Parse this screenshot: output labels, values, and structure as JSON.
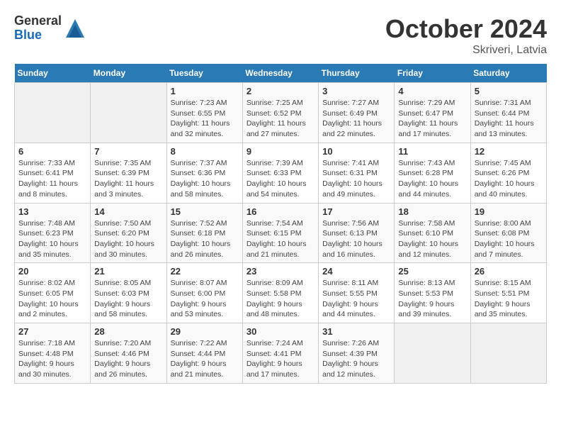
{
  "logo": {
    "general": "General",
    "blue": "Blue"
  },
  "title": {
    "month": "October 2024",
    "location": "Skriveri, Latvia"
  },
  "weekdays": [
    "Sunday",
    "Monday",
    "Tuesday",
    "Wednesday",
    "Thursday",
    "Friday",
    "Saturday"
  ],
  "weeks": [
    [
      null,
      null,
      {
        "day": 1,
        "sunrise": "7:23 AM",
        "sunset": "6:55 PM",
        "daylight": "11 hours and 32 minutes."
      },
      {
        "day": 2,
        "sunrise": "7:25 AM",
        "sunset": "6:52 PM",
        "daylight": "11 hours and 27 minutes."
      },
      {
        "day": 3,
        "sunrise": "7:27 AM",
        "sunset": "6:49 PM",
        "daylight": "11 hours and 22 minutes."
      },
      {
        "day": 4,
        "sunrise": "7:29 AM",
        "sunset": "6:47 PM",
        "daylight": "11 hours and 17 minutes."
      },
      {
        "day": 5,
        "sunrise": "7:31 AM",
        "sunset": "6:44 PM",
        "daylight": "11 hours and 13 minutes."
      }
    ],
    [
      {
        "day": 6,
        "sunrise": "7:33 AM",
        "sunset": "6:41 PM",
        "daylight": "11 hours and 8 minutes."
      },
      {
        "day": 7,
        "sunrise": "7:35 AM",
        "sunset": "6:39 PM",
        "daylight": "11 hours and 3 minutes."
      },
      {
        "day": 8,
        "sunrise": "7:37 AM",
        "sunset": "6:36 PM",
        "daylight": "10 hours and 58 minutes."
      },
      {
        "day": 9,
        "sunrise": "7:39 AM",
        "sunset": "6:33 PM",
        "daylight": "10 hours and 54 minutes."
      },
      {
        "day": 10,
        "sunrise": "7:41 AM",
        "sunset": "6:31 PM",
        "daylight": "10 hours and 49 minutes."
      },
      {
        "day": 11,
        "sunrise": "7:43 AM",
        "sunset": "6:28 PM",
        "daylight": "10 hours and 44 minutes."
      },
      {
        "day": 12,
        "sunrise": "7:45 AM",
        "sunset": "6:26 PM",
        "daylight": "10 hours and 40 minutes."
      }
    ],
    [
      {
        "day": 13,
        "sunrise": "7:48 AM",
        "sunset": "6:23 PM",
        "daylight": "10 hours and 35 minutes."
      },
      {
        "day": 14,
        "sunrise": "7:50 AM",
        "sunset": "6:20 PM",
        "daylight": "10 hours and 30 minutes."
      },
      {
        "day": 15,
        "sunrise": "7:52 AM",
        "sunset": "6:18 PM",
        "daylight": "10 hours and 26 minutes."
      },
      {
        "day": 16,
        "sunrise": "7:54 AM",
        "sunset": "6:15 PM",
        "daylight": "10 hours and 21 minutes."
      },
      {
        "day": 17,
        "sunrise": "7:56 AM",
        "sunset": "6:13 PM",
        "daylight": "10 hours and 16 minutes."
      },
      {
        "day": 18,
        "sunrise": "7:58 AM",
        "sunset": "6:10 PM",
        "daylight": "10 hours and 12 minutes."
      },
      {
        "day": 19,
        "sunrise": "8:00 AM",
        "sunset": "6:08 PM",
        "daylight": "10 hours and 7 minutes."
      }
    ],
    [
      {
        "day": 20,
        "sunrise": "8:02 AM",
        "sunset": "6:05 PM",
        "daylight": "10 hours and 2 minutes."
      },
      {
        "day": 21,
        "sunrise": "8:05 AM",
        "sunset": "6:03 PM",
        "daylight": "9 hours and 58 minutes."
      },
      {
        "day": 22,
        "sunrise": "8:07 AM",
        "sunset": "6:00 PM",
        "daylight": "9 hours and 53 minutes."
      },
      {
        "day": 23,
        "sunrise": "8:09 AM",
        "sunset": "5:58 PM",
        "daylight": "9 hours and 48 minutes."
      },
      {
        "day": 24,
        "sunrise": "8:11 AM",
        "sunset": "5:55 PM",
        "daylight": "9 hours and 44 minutes."
      },
      {
        "day": 25,
        "sunrise": "8:13 AM",
        "sunset": "5:53 PM",
        "daylight": "9 hours and 39 minutes."
      },
      {
        "day": 26,
        "sunrise": "8:15 AM",
        "sunset": "5:51 PM",
        "daylight": "9 hours and 35 minutes."
      }
    ],
    [
      {
        "day": 27,
        "sunrise": "7:18 AM",
        "sunset": "4:48 PM",
        "daylight": "9 hours and 30 minutes."
      },
      {
        "day": 28,
        "sunrise": "7:20 AM",
        "sunset": "4:46 PM",
        "daylight": "9 hours and 26 minutes."
      },
      {
        "day": 29,
        "sunrise": "7:22 AM",
        "sunset": "4:44 PM",
        "daylight": "9 hours and 21 minutes."
      },
      {
        "day": 30,
        "sunrise": "7:24 AM",
        "sunset": "4:41 PM",
        "daylight": "9 hours and 17 minutes."
      },
      {
        "day": 31,
        "sunrise": "7:26 AM",
        "sunset": "4:39 PM",
        "daylight": "9 hours and 12 minutes."
      },
      null,
      null
    ]
  ]
}
